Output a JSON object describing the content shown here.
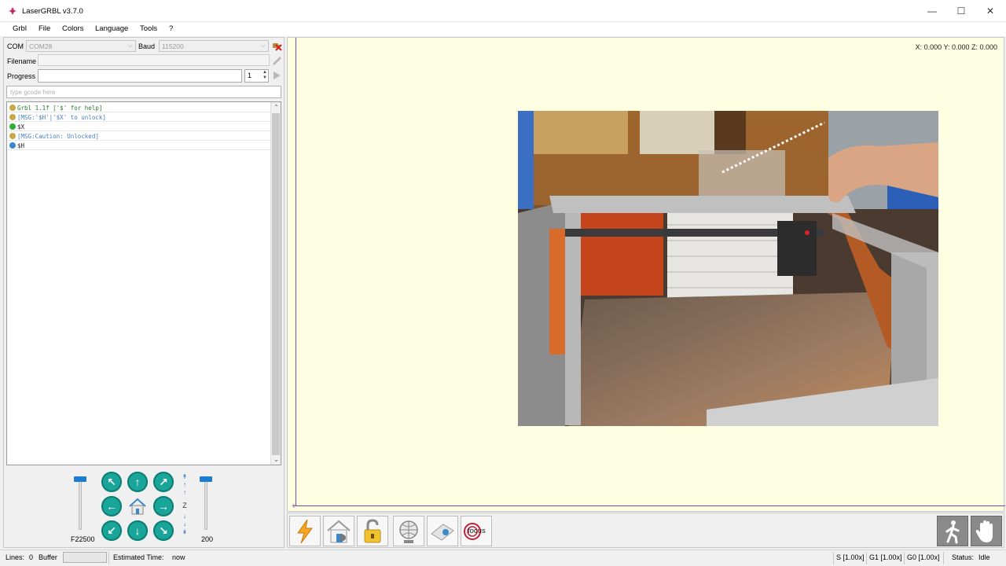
{
  "window": {
    "title": "LaserGRBL v3.7.0",
    "minimize": "—",
    "maximize": "☐",
    "close": "✕"
  },
  "menu": [
    "Grbl",
    "File",
    "Colors",
    "Language",
    "Tools",
    "?"
  ],
  "connection": {
    "com_label": "COM",
    "com_value": "COM28",
    "baud_label": "Baud",
    "baud_value": "115200",
    "filename_label": "Filename",
    "filename_value": "",
    "progress_label": "Progress",
    "progress_value": "",
    "passes_value": "1"
  },
  "command_input": {
    "placeholder": "type gcode here"
  },
  "console": [
    {
      "text": "Grbl 1.1f ['$' for help]",
      "color": "green",
      "icon": "message-icon"
    },
    {
      "text": "[MSG:'$H'|'$X' to unlock]",
      "color": "blue",
      "icon": "message-icon"
    },
    {
      "text": "$X",
      "color": "black",
      "icon": "ok-check-icon"
    },
    {
      "text": "[MSG:Caution: Unlocked]",
      "color": "blue",
      "icon": "message-icon"
    },
    {
      "text": "$H",
      "color": "black",
      "icon": "pending-icon"
    }
  ],
  "jog": {
    "feed_label": "F22500",
    "step_label": "200",
    "z_label": "Z",
    "feed_level": 1.0,
    "step_level": 1.0
  },
  "canvas": {
    "coords": "X: 0.000 Y: 0.000 Z: 0.000",
    "background": "#fefee2"
  },
  "toolbar": {
    "left": [
      "reset-lightning-icon",
      "homing-icon",
      "unlock-icon",
      "center-globe-icon",
      "corner-icon",
      "focus-icon"
    ],
    "focus_text": "focus",
    "right": [
      "walk-icon",
      "stop-hand-icon"
    ]
  },
  "status": {
    "lines_label": "Lines:",
    "lines_value": "0",
    "buffer_label": "Buffer",
    "estimated_label": "Estimated Time:",
    "estimated_value": "now",
    "s_override": "S [1.00x]",
    "g1_override": "G1 [1.00x]",
    "g0_override": "G0 [1.00x]",
    "status_label": "Status:",
    "status_value": "Idle"
  },
  "colors": {
    "accent_teal": "#1aa59a",
    "slider_blue": "#1e7bd2",
    "axis_purple": "#7a4a8a"
  }
}
